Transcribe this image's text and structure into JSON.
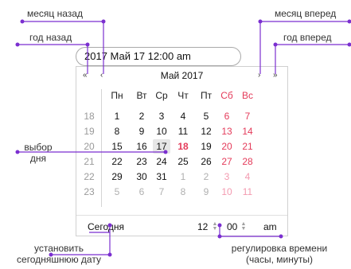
{
  "annotations": {
    "prev_month": "месяц назад",
    "prev_year": "год назад",
    "next_month": "месяц вперед",
    "next_year": "год вперед",
    "day_select": "выбор\nдня",
    "set_today": "установить\nсегодняшнюю дату",
    "time_adjust": "регулировка времени\n(часы, минуты)"
  },
  "input": {
    "value": "2017 Май 17 12:00 am"
  },
  "calendar": {
    "title": "Май 2017",
    "nav": {
      "prev_year": "«",
      "prev_month": "‹",
      "next_month": "›",
      "next_year": "»"
    },
    "weekdays": [
      "Пн",
      "Вт",
      "Ср",
      "Чт",
      "Пт",
      "Сб",
      "Вс"
    ],
    "weeks": [
      {
        "num": "18",
        "days": [
          "1",
          "2",
          "3",
          "4",
          "5",
          "6",
          "7"
        ]
      },
      {
        "num": "19",
        "days": [
          "8",
          "9",
          "10",
          "11",
          "12",
          "13",
          "14"
        ]
      },
      {
        "num": "20",
        "days": [
          "15",
          "16",
          "17",
          "18",
          "19",
          "20",
          "21"
        ]
      },
      {
        "num": "21",
        "days": [
          "22",
          "23",
          "24",
          "25",
          "26",
          "27",
          "28"
        ]
      },
      {
        "num": "22",
        "days": [
          "29",
          "30",
          "31",
          "1",
          "2",
          "3",
          "4"
        ]
      },
      {
        "num": "23",
        "days": [
          "5",
          "6",
          "7",
          "8",
          "9",
          "10",
          "11"
        ]
      }
    ],
    "selected_day": "17",
    "today_day": "18",
    "footer": {
      "today_label": "Сегодня",
      "hour": "12",
      "minute": "00",
      "ampm": "am"
    }
  },
  "colors": {
    "accent": "#7b2fd0",
    "weekend": "#e43b5a",
    "muted": "#b0b0b0"
  }
}
